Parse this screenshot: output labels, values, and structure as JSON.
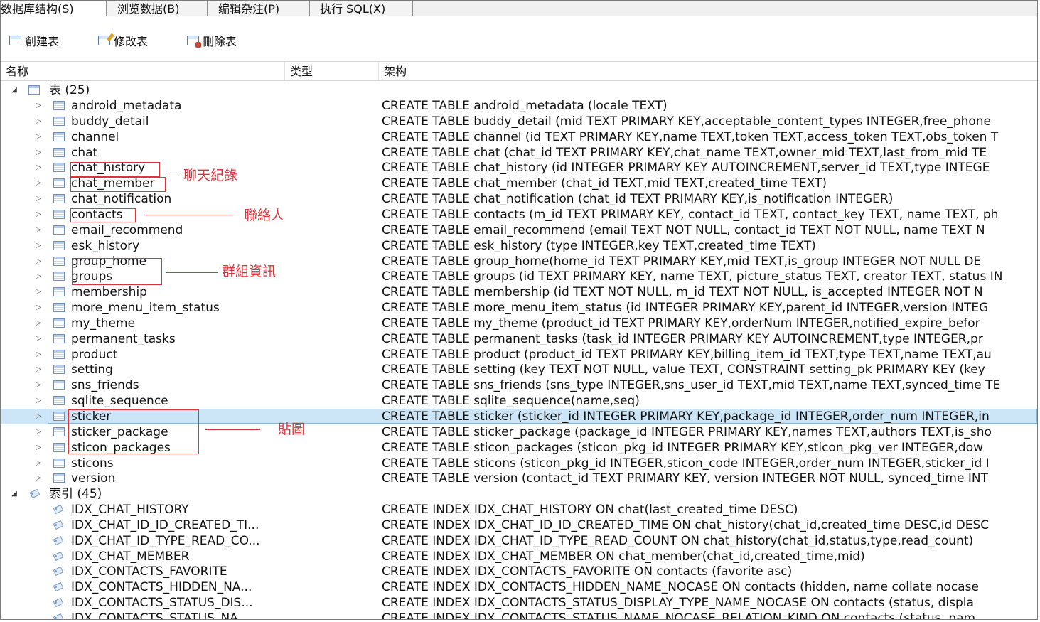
{
  "tabs": [
    {
      "label": "数据库结构(S)",
      "active": true
    },
    {
      "label": "浏览数据(B)",
      "active": false
    },
    {
      "label": "编辑杂注(P)",
      "active": false
    },
    {
      "label": "执行 SQL(X)",
      "active": false
    }
  ],
  "toolbar": {
    "create_label": "創建表",
    "modify_label": "修改表",
    "delete_label": "刪除表"
  },
  "columns": {
    "name": "名称",
    "type": "类型",
    "schema": "架构"
  },
  "tables_group": {
    "label": "表 (25)",
    "rows": [
      {
        "name": "android_metadata",
        "schema": "CREATE TABLE android_metadata (locale TEXT)"
      },
      {
        "name": "buddy_detail",
        "schema": "CREATE TABLE buddy_detail (mid TEXT PRIMARY KEY,acceptable_content_types INTEGER,free_phone"
      },
      {
        "name": "channel",
        "schema": "CREATE TABLE channel (id TEXT PRIMARY KEY,name TEXT,token TEXT,access_token TEXT,obs_token T"
      },
      {
        "name": "chat",
        "schema": "CREATE TABLE chat (chat_id TEXT PRIMARY KEY,chat_name TEXT,owner_mid TEXT,last_from_mid TE"
      },
      {
        "name": "chat_history",
        "schema": "CREATE TABLE chat_history (id INTEGER PRIMARY KEY AUTOINCREMENT,server_id TEXT,type INTEGE"
      },
      {
        "name": "chat_member",
        "schema": "CREATE TABLE chat_member (chat_id TEXT,mid TEXT,created_time TEXT)"
      },
      {
        "name": "chat_notification",
        "schema": "CREATE TABLE chat_notification (chat_id TEXT PRIMARY KEY,is_notification INTEGER)"
      },
      {
        "name": "contacts",
        "schema": "CREATE TABLE contacts (m_id TEXT PRIMARY KEY, contact_id TEXT, contact_key TEXT, name TEXT, ph"
      },
      {
        "name": "email_recommend",
        "schema": "CREATE TABLE email_recommend (email TEXT NOT NULL, contact_id TEXT NOT NULL, name TEXT N"
      },
      {
        "name": "esk_history",
        "schema": "CREATE TABLE esk_history (type INTEGER,key TEXT,created_time TEXT)"
      },
      {
        "name": "group_home",
        "schema": "CREATE TABLE group_home(home_id TEXT PRIMARY KEY,mid TEXT,is_group INTEGER NOT NULL DE"
      },
      {
        "name": "groups",
        "schema": "CREATE TABLE groups (id TEXT PRIMARY KEY, name TEXT, picture_status TEXT, creator TEXT, status IN"
      },
      {
        "name": "membership",
        "schema": "CREATE TABLE membership (id TEXT NOT NULL, m_id TEXT NOT NULL, is_accepted INTEGER NOT N"
      },
      {
        "name": "more_menu_item_status",
        "schema": "CREATE TABLE more_menu_item_status (id INTEGER PRIMARY KEY,parent_id INTEGER,version INTEG"
      },
      {
        "name": "my_theme",
        "schema": "CREATE TABLE my_theme (product_id TEXT PRIMARY KEY,orderNum INTEGER,notified_expire_befor"
      },
      {
        "name": "permanent_tasks",
        "schema": "CREATE TABLE permanent_tasks (task_id INTEGER PRIMARY KEY AUTOINCREMENT,type INTEGER,pr"
      },
      {
        "name": "product",
        "schema": "CREATE TABLE product (product_id TEXT PRIMARY KEY,billing_item_id TEXT,type TEXT,name TEXT,au"
      },
      {
        "name": "setting",
        "schema": "CREATE TABLE setting (key TEXT NOT NULL, value TEXT, CONSTRAINT setting_pk PRIMARY KEY (key"
      },
      {
        "name": "sns_friends",
        "schema": "CREATE TABLE sns_friends (sns_type INTEGER,sns_user_id TEXT,mid TEXT,name TEXT,synced_time TE"
      },
      {
        "name": "sqlite_sequence",
        "schema": "CREATE TABLE sqlite_sequence(name,seq)"
      },
      {
        "name": "sticker",
        "schema": "CREATE TABLE sticker (sticker_id INTEGER PRIMARY KEY,package_id INTEGER,order_num INTEGER,in",
        "selected": true
      },
      {
        "name": "sticker_package",
        "schema": "CREATE TABLE sticker_package (package_id INTEGER PRIMARY KEY,names TEXT,authors TEXT,is_sho"
      },
      {
        "name": "sticon_packages",
        "schema": "CREATE TABLE sticon_packages (sticon_pkg_id INTEGER PRIMARY KEY,sticon_pkg_ver INTEGER,dow"
      },
      {
        "name": "sticons",
        "schema": "CREATE TABLE sticons (sticon_pkg_id INTEGER,sticon_code INTEGER,order_num INTEGER,sticker_id I"
      },
      {
        "name": "version",
        "schema": "CREATE TABLE version (contact_id TEXT PRIMARY KEY, version INTEGER NOT NULL, synced_time INT"
      }
    ]
  },
  "index_group": {
    "label": "索引 (45)",
    "rows": [
      {
        "name": "IDX_CHAT_HISTORY",
        "schema": "CREATE INDEX IDX_CHAT_HISTORY ON chat(last_created_time DESC)"
      },
      {
        "name": "IDX_CHAT_ID_ID_CREATED_TI...",
        "schema": "CREATE INDEX IDX_CHAT_ID_ID_CREATED_TIME ON chat_history(chat_id,created_time DESC,id DESC"
      },
      {
        "name": "IDX_CHAT_ID_TYPE_READ_CO...",
        "schema": "CREATE INDEX IDX_CHAT_ID_TYPE_READ_COUNT ON chat_history(chat_id,status,type,read_count)"
      },
      {
        "name": "IDX_CHAT_MEMBER",
        "schema": "CREATE INDEX IDX_CHAT_MEMBER ON chat_member(chat_id,created_time,mid)"
      },
      {
        "name": "IDX_CONTACTS_FAVORITE",
        "schema": "CREATE INDEX IDX_CONTACTS_FAVORITE ON contacts (favorite asc)"
      },
      {
        "name": "IDX_CONTACTS_HIDDEN_NA...",
        "schema": "CREATE INDEX IDX_CONTACTS_HIDDEN_NAME_NOCASE ON contacts (hidden, name collate nocase"
      },
      {
        "name": "IDX_CONTACTS_STATUS_DIS...",
        "schema": "CREATE INDEX IDX_CONTACTS_STATUS_DISPLAY_TYPE_NAME_NOCASE ON contacts (status, displa"
      },
      {
        "name": "IDX_CONTACTS_STATUS_NA...",
        "schema": "CREATE INDEX IDX_CONTACTS_STATUS_NAME_NOCASE_RELATION_KIND ON contacts (status, nam"
      }
    ]
  },
  "annotations": [
    {
      "label": "聊天紀錄"
    },
    {
      "label": "聯絡人"
    },
    {
      "label": "群組資訊"
    },
    {
      "label": "貼圖"
    }
  ],
  "colors": {
    "annotation": "#e0323a",
    "selection_bg": "#cde6f7",
    "selection_border": "#7db4dd"
  },
  "icons": {
    "table_row": "table-icon",
    "index_row": "index-icon",
    "create": "create-table-icon",
    "modify": "modify-table-icon",
    "delete": "delete-table-icon"
  }
}
